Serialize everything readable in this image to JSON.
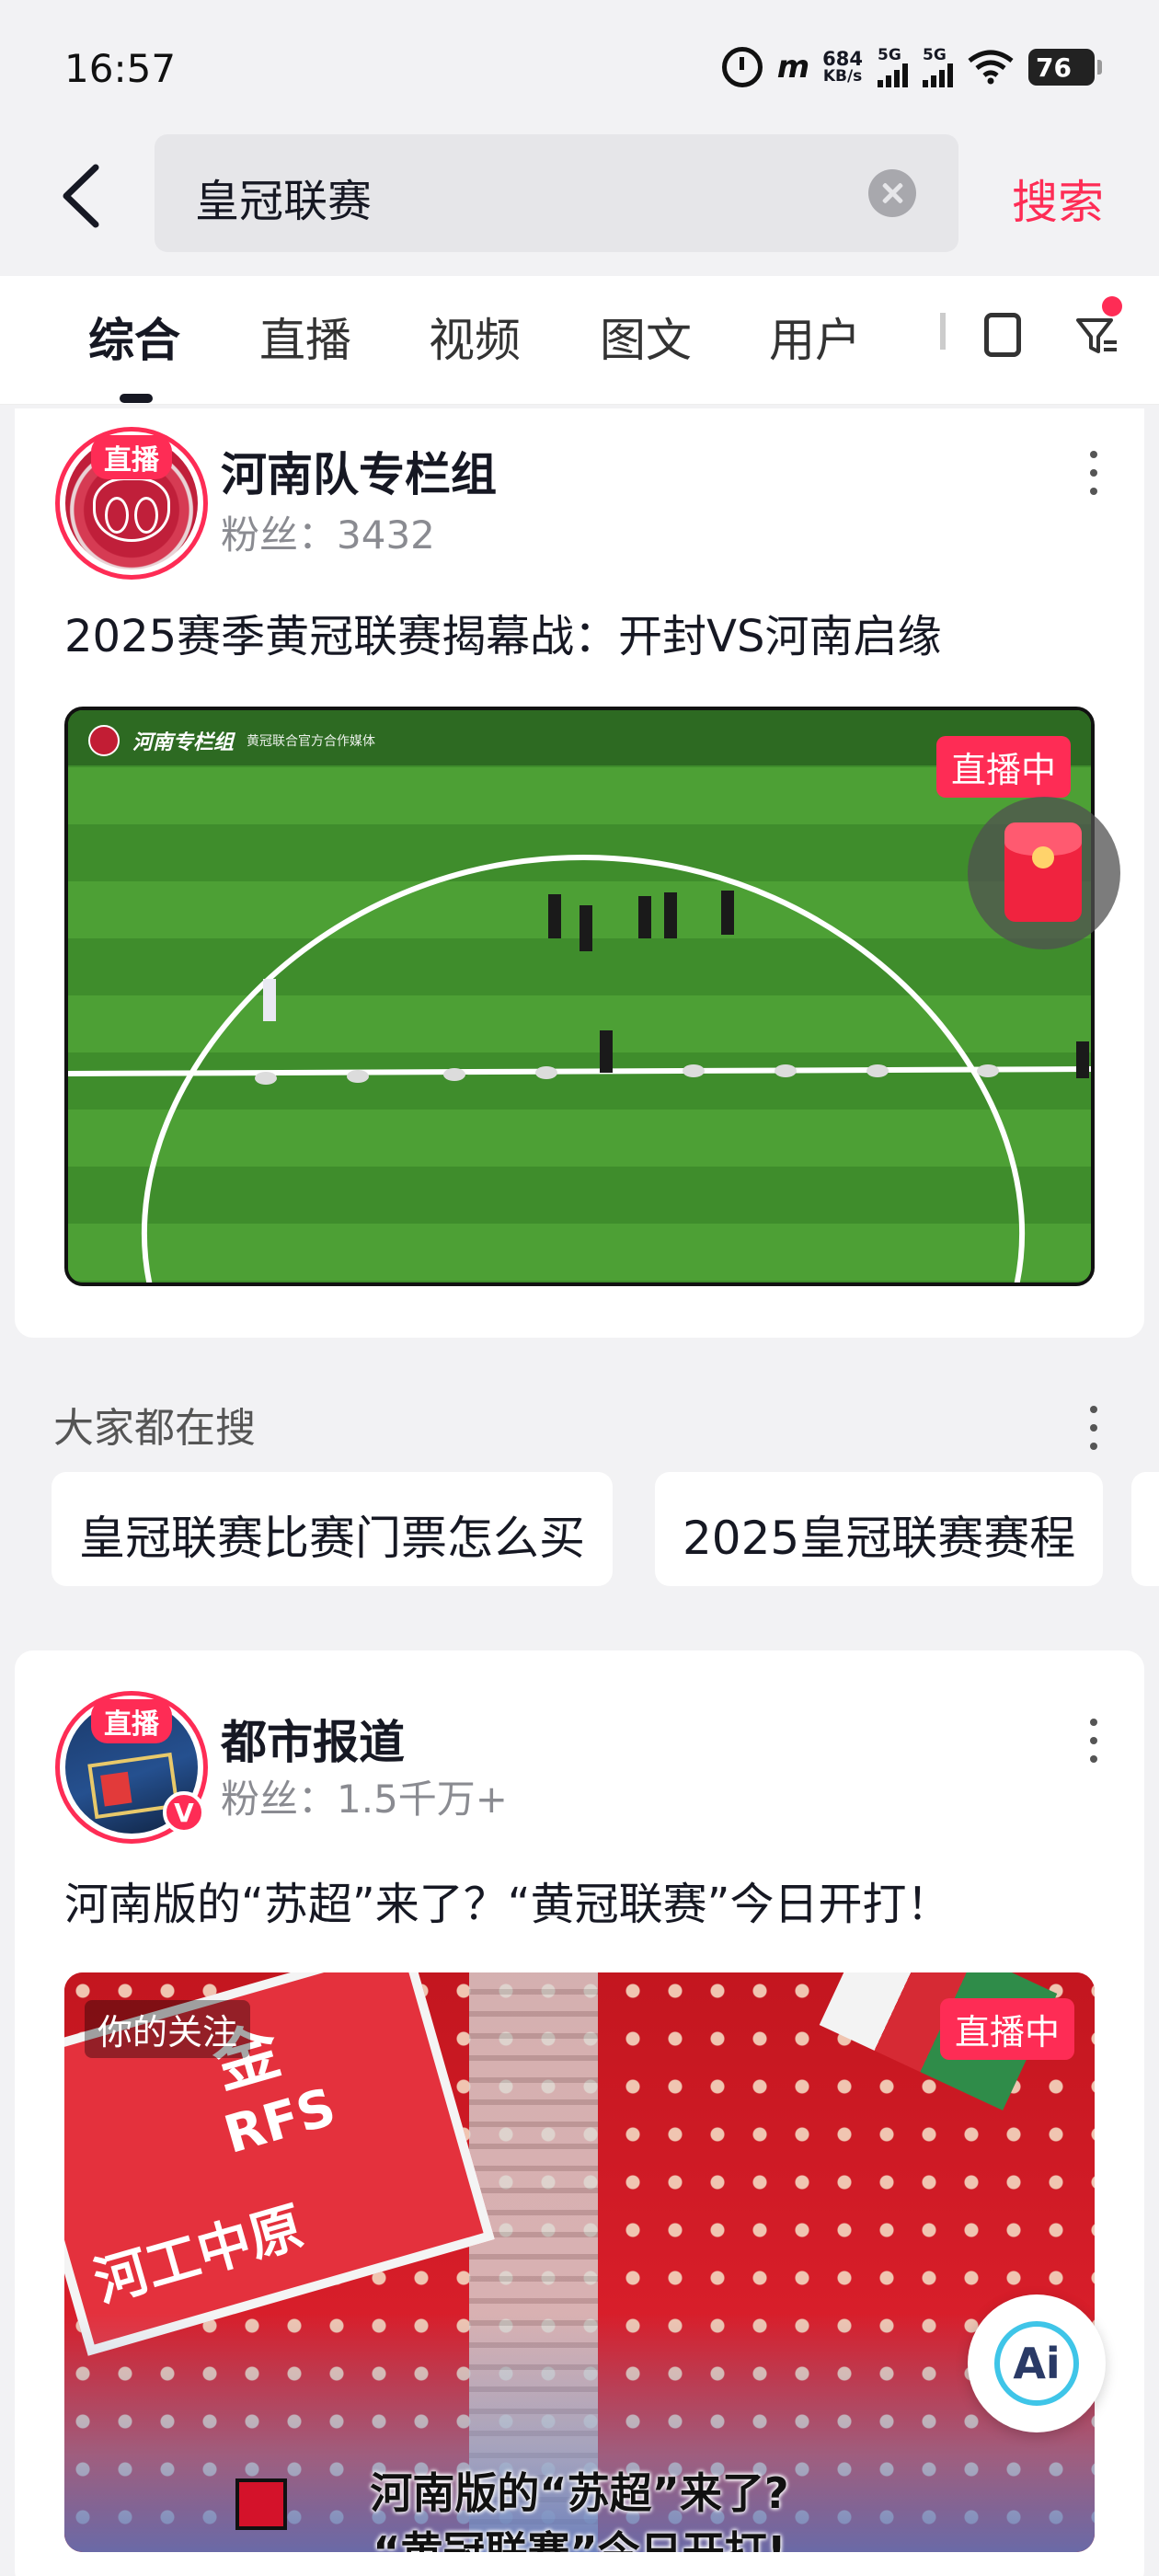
{
  "status_bar": {
    "time": "16:57",
    "net_speed_value": "684",
    "net_speed_unit": "KB/s",
    "sim1": "5G",
    "sim2": "5G",
    "battery": "76"
  },
  "search": {
    "query": "皇冠联赛",
    "button_label": "搜索"
  },
  "tabs": [
    {
      "label": "综合",
      "active": true
    },
    {
      "label": "直播",
      "active": false
    },
    {
      "label": "视频",
      "active": false
    },
    {
      "label": "图文",
      "active": false
    },
    {
      "label": "用户",
      "active": false
    }
  ],
  "results": [
    {
      "account": "河南队专栏组",
      "fans": "粉丝：3432",
      "live_tag": "直播",
      "title": "2025赛季黄冠联赛揭幕战：开封VS河南启缘",
      "badge": "直播中",
      "overlay_brand": "河南专栏组",
      "overlay_sub": "黄冠联合官方合作媒体"
    },
    {
      "account": "都市报道",
      "fans": "粉丝：1.5千万+",
      "live_tag": "直播",
      "verified": "V",
      "title": "河南版的“苏超”来了？“黄冠联赛”今日开打！",
      "badge": "直播中",
      "follow_tag": "你的关注",
      "caption_line1": "河南版的“苏超”来了?",
      "caption_line2": "“黄冠联赛”今日开打!"
    }
  ],
  "hot_search": {
    "title": "大家都在搜",
    "items": [
      "皇冠联赛比赛门票怎么买",
      "2025皇冠联赛赛程"
    ]
  },
  "floating": {
    "ai_label": "Ai"
  },
  "colors": {
    "accent": "#fe2c55",
    "text": "#161823",
    "muted": "#8a8b91",
    "background": "#f2f2f4"
  }
}
